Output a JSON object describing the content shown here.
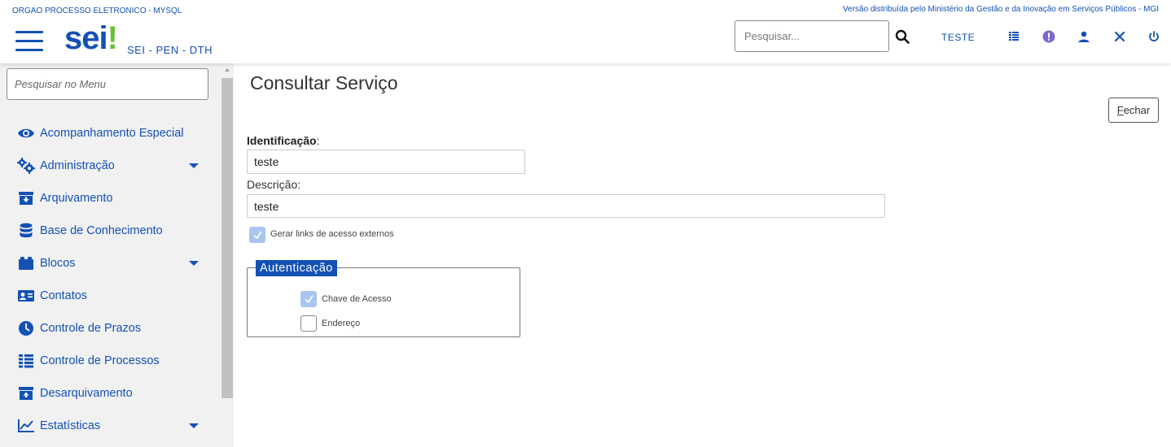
{
  "header": {
    "org_name": "ORGAO PROCESSO ELETRONICO - MYSQL",
    "version_text": "Versão distribuída pelo Ministério da Gestão e da Inovação em Serviços Públicos - MGI",
    "logo_text": "sei",
    "logo_bang": "!",
    "system_sub": "SEI - PEN - DTH",
    "search_placeholder": "Pesquisar...",
    "unit": "TESTE",
    "icons": [
      "menu-icon",
      "search-icon",
      "grid-list-icon",
      "alert-icon",
      "user-icon",
      "tools-icon",
      "power-icon"
    ],
    "accent_color": "#1351b4"
  },
  "sidebar": {
    "search_placeholder": "Pesquisar no Menu",
    "items": [
      {
        "label": "Acompanhamento Especial",
        "icon": "eye-icon",
        "has_submenu": false
      },
      {
        "label": "Administração",
        "icon": "gears-icon",
        "has_submenu": true
      },
      {
        "label": "Arquivamento",
        "icon": "archive-icon",
        "has_submenu": false
      },
      {
        "label": "Base de Conhecimento",
        "icon": "database-icon",
        "has_submenu": false
      },
      {
        "label": "Blocos",
        "icon": "blocks-icon",
        "has_submenu": true
      },
      {
        "label": "Contatos",
        "icon": "contact-card-icon",
        "has_submenu": false
      },
      {
        "label": "Controle de Prazos",
        "icon": "clock-icon",
        "has_submenu": false
      },
      {
        "label": "Controle de Processos",
        "icon": "list-icon",
        "has_submenu": false
      },
      {
        "label": "Desarquivamento",
        "icon": "unarchive-icon",
        "has_submenu": false
      },
      {
        "label": "Estatísticas",
        "icon": "chart-line-icon",
        "has_submenu": true
      }
    ]
  },
  "main": {
    "title": "Consultar Serviço",
    "close_button": {
      "accesskey_letter": "F",
      "rest": "echar"
    },
    "identificacao": {
      "label": "Identificação",
      "colon": ":",
      "value": "teste"
    },
    "descricao": {
      "label": "Descrição:",
      "value": "teste"
    },
    "gerar_links": {
      "label": "Gerar links de acesso externos",
      "checked": true
    },
    "autenticacao": {
      "legend": "Autenticação",
      "options": [
        {
          "label": "Chave de Acesso",
          "checked": true
        },
        {
          "label": "Endereço",
          "checked": false
        }
      ]
    }
  }
}
